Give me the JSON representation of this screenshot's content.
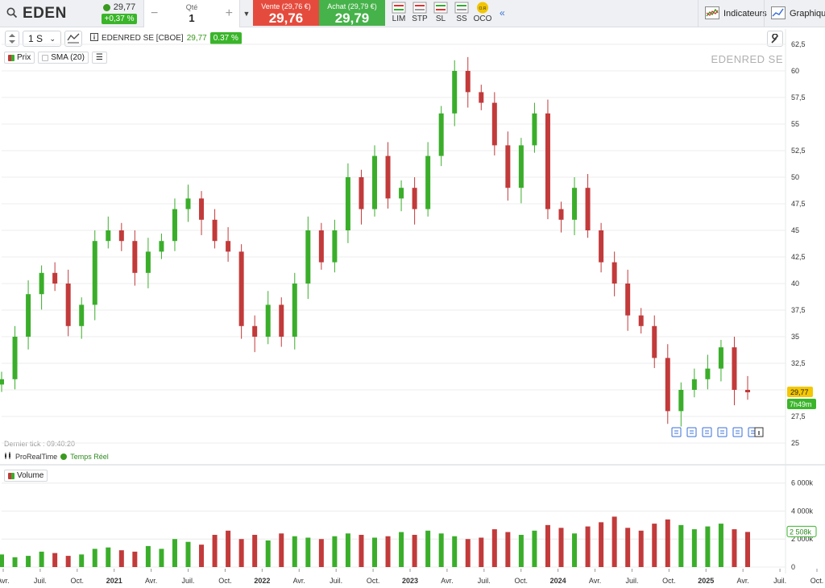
{
  "header": {
    "symbol": "EDEN",
    "last_price": "29,77",
    "change_pct": "+0,37 %",
    "qty_label": "Qté",
    "qty_value": "1",
    "sell_label": "Vente (29,76 €)",
    "sell_price": "29,76",
    "buy_label": "Achat (29,79 €)",
    "buy_price": "29,79",
    "order_types": [
      "LIM",
      "STP",
      "SL",
      "SS",
      "OCO"
    ],
    "oco_badge": "O.R",
    "indicators_label": "Indicateurs",
    "chart_label": "Graphique"
  },
  "toolbar": {
    "period": "1 S",
    "instrument": "EDENRED SE [CBOE]",
    "instrument_price": "29,77",
    "instrument_change": "0.37 %"
  },
  "legend": {
    "price": "Prix",
    "sma": "SMA (20)",
    "volume": "Volume"
  },
  "watermark": "EDENRED SE",
  "last_tick": "Dernier tick : 09:40:20",
  "provider": "ProRealTime",
  "realtime": "Temps Réel",
  "colors": {
    "up": "#3aae2a",
    "down": "#c23a3a",
    "accent": "#3a6fd8",
    "sell": "#e54b3d",
    "buy": "#46b24a"
  },
  "chart_data": [
    {
      "type": "candlestick",
      "title": "EDENRED SE",
      "timeframe": "weekly",
      "ylim": [
        25,
        62.5
      ],
      "y_ticks": [
        "25",
        "27,5",
        "30",
        "32,5",
        "35",
        "37,5",
        "40",
        "42,5",
        "45",
        "47,5",
        "50",
        "52,5",
        "55",
        "57,5",
        "60",
        "62,5"
      ],
      "x_ticks": [
        "Avr.",
        "Juil.",
        "Oct.",
        "2021",
        "Avr.",
        "Juil.",
        "Oct.",
        "2022",
        "Avr.",
        "Juil.",
        "Oct.",
        "2023",
        "Avr.",
        "Juil.",
        "Oct.",
        "2024",
        "Avr.",
        "Juil.",
        "Oct.",
        "2025",
        "Avr.",
        "Juil.",
        "Oct."
      ],
      "current_price": "29,77",
      "countdown": "7h49m",
      "closes": [
        31,
        35,
        39,
        41,
        40,
        36,
        38,
        44,
        45,
        44,
        41,
        43,
        44,
        47,
        48,
        46,
        44,
        43,
        36,
        35,
        38,
        35,
        40,
        45,
        42,
        45,
        50,
        47,
        52,
        48,
        49,
        47,
        52,
        56,
        60,
        58,
        57,
        53,
        49,
        53,
        56,
        47,
        46,
        49,
        45,
        42,
        40,
        37,
        36,
        33,
        28,
        30,
        31,
        32,
        34,
        30,
        29.77
      ]
    },
    {
      "type": "bar",
      "title": "Volume",
      "ylim": [
        0,
        6500
      ],
      "y_ticks": [
        "0",
        "2 000k",
        "4 000k",
        "6 000k"
      ],
      "current_value": "2 508k",
      "values_k": [
        900,
        700,
        800,
        1100,
        1000,
        800,
        900,
        1300,
        1400,
        1200,
        1100,
        1500,
        1300,
        2000,
        1800,
        1600,
        2300,
        2600,
        2000,
        2300,
        1900,
        2400,
        2200,
        2100,
        2000,
        2200,
        2400,
        2300,
        2100,
        2200,
        2500,
        2300,
        2600,
        2400,
        2200,
        2000,
        2100,
        2700,
        2500,
        2300,
        2600,
        3000,
        2800,
        2400,
        2900,
        3200,
        3600,
        2800,
        2600,
        3100,
        3400,
        3000,
        2700,
        2900,
        3100,
        2700,
        2508
      ]
    }
  ]
}
